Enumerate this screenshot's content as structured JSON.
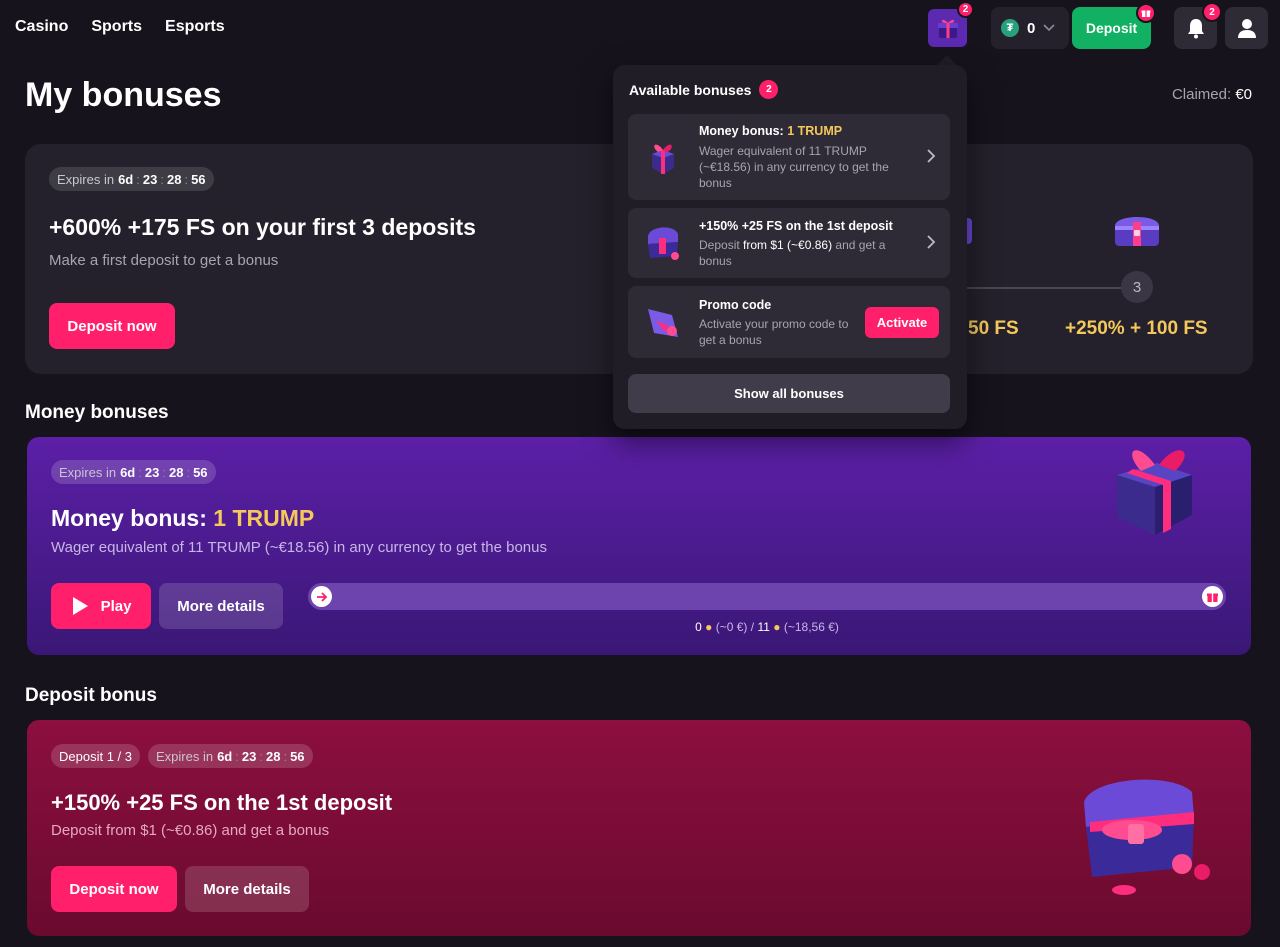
{
  "nav": {
    "links": [
      "Casino",
      "Sports",
      "Esports"
    ],
    "gift_badge": "2",
    "balance_value": "0",
    "currency_symbol": "₮",
    "deposit_label": "Deposit",
    "notif_badge": "2"
  },
  "page": {
    "title": "My bonuses",
    "claimed_label": "Claimed:",
    "claimed_value": "€0"
  },
  "first_deposit": {
    "expires_label": "Expires in",
    "timer": {
      "d": "6d",
      "h": "23",
      "m": "28",
      "s": "56"
    },
    "title": "+600% +175 FS on your first 3 deposits",
    "subtitle": "Make a first deposit to get a bonus",
    "cta": "Deposit now",
    "step2_reward_partial": "50 FS",
    "step3_number": "3",
    "step3_reward": "+250% + 100 FS"
  },
  "money_section": {
    "title": "Money bonuses",
    "expires_label": "Expires in",
    "timer": {
      "d": "6d",
      "h": "23",
      "m": "28",
      "s": "56"
    },
    "card_title_prefix": "Money bonus:",
    "card_title_accent": "1 TRUMP",
    "subtitle": "Wager equivalent of 11 TRUMP (~€18.56) in any currency to get the bonus",
    "play_label": "Play",
    "details_label": "More details",
    "progress": 0,
    "progress_text_current": "0",
    "progress_text_current_eur": "(~0 €)",
    "progress_text_total": "11",
    "progress_text_total_eur": "(~18,56 €)"
  },
  "deposit_section": {
    "title": "Deposit bonus",
    "step_pill": "Deposit 1 / 3",
    "expires_label": "Expires in",
    "timer": {
      "d": "6d",
      "h": "23",
      "m": "28",
      "s": "56"
    },
    "card_title": "+150% +25 FS on the 1st deposit",
    "subtitle": "Deposit from $1 (~€0.86) and get a bonus",
    "cta": "Deposit now",
    "details_label": "More details"
  },
  "popup": {
    "title": "Available bonuses",
    "count": "2",
    "items": [
      {
        "title_prefix": "Money bonus:",
        "title_accent": "1 TRUMP",
        "desc": "Wager equivalent of 11 TRUMP (~€18.56) in any currency to get the bonus"
      },
      {
        "title": "+150% +25 FS on the 1st deposit",
        "desc_a": "Deposit",
        "desc_b": "from $1 (~€0.86)",
        "desc_c": "and get a bonus"
      },
      {
        "title": "Promo code",
        "desc": "Activate your promo code to get a bonus",
        "action": "Activate"
      }
    ],
    "show_all": "Show all bonuses"
  },
  "colors": {
    "accent_pink": "#ff1f6b",
    "deposit_green": "#12b062",
    "gold": "#f5c85b",
    "money_card": "#5c1fa7",
    "deposit_card": "#8c0f3f"
  }
}
